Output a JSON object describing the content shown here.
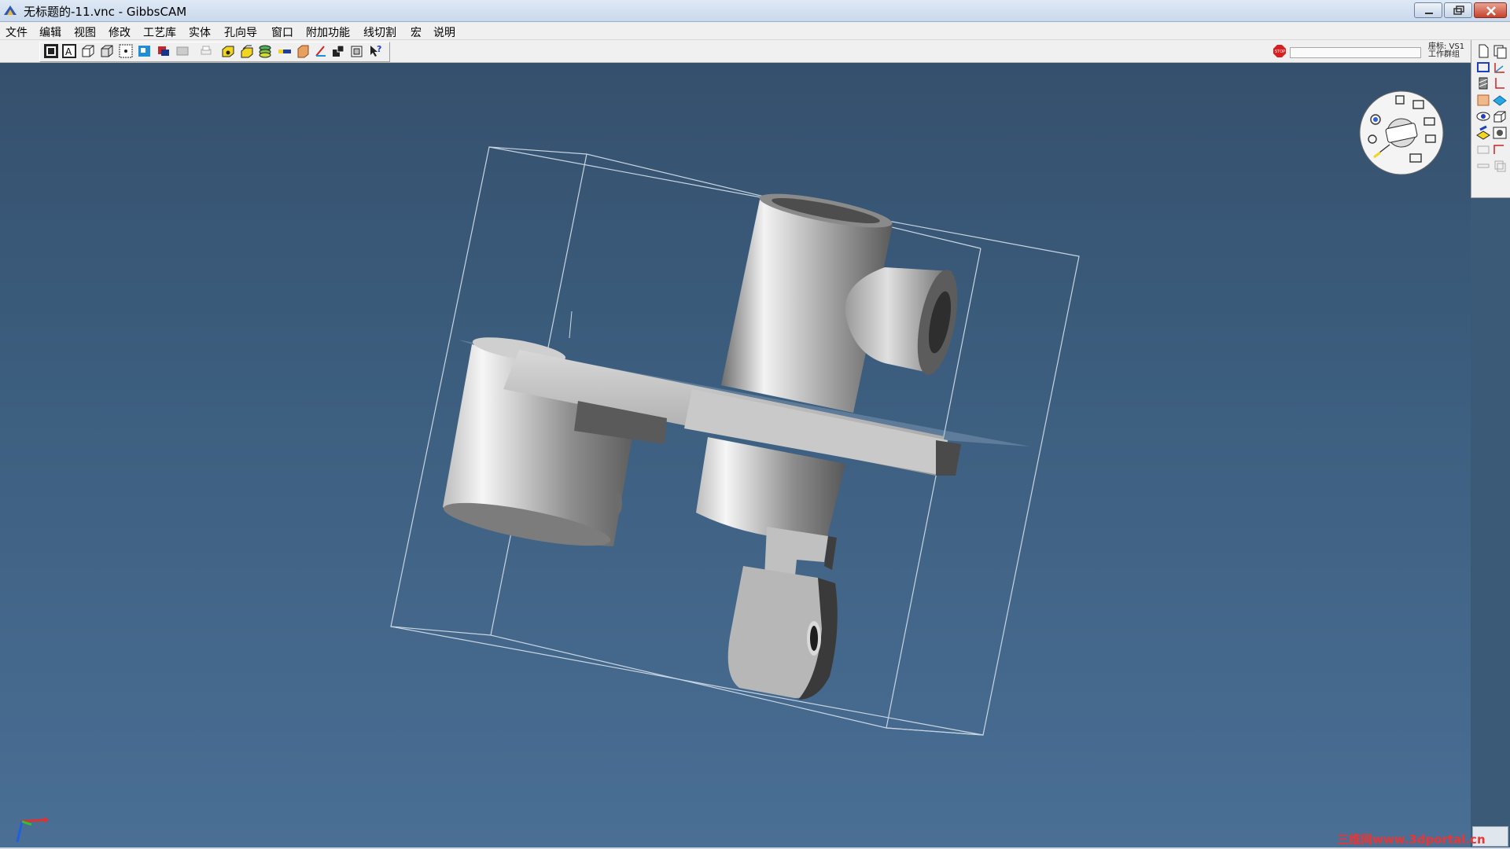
{
  "window": {
    "title": "无标题的-11.vnc - GibbsCAM"
  },
  "menu": {
    "items": [
      "文件",
      "编辑",
      "视图",
      "修改",
      "工艺库",
      "实体",
      "孔向导",
      "窗口",
      "附加功能",
      "线切割",
      "宏",
      "说明"
    ]
  },
  "toolbar": {
    "coord_label_line1": "座标: VS1",
    "coord_label_line2": "工作群组"
  },
  "watermark": {
    "text": "三维网www.3dportal.cn"
  },
  "colors": {
    "viewport_top": "#35506d",
    "viewport_bottom": "#4a6f95",
    "part_gray": "#a8a8a8",
    "close_red": "#c6432d"
  },
  "icons": {
    "app": "gibbscam-logo-icon",
    "stop": "stop-icon",
    "view_cube": "view-navigation-wheel-icon",
    "axis": "axis-triad-icon"
  }
}
